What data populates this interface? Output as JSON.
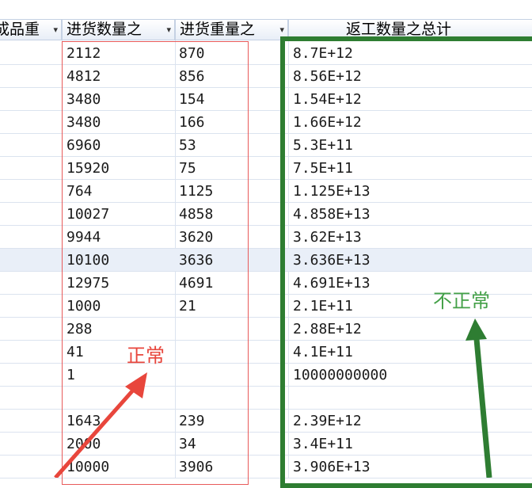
{
  "headers": {
    "col0": "成品重",
    "col1": "进货数量之",
    "col2": "进货重量之",
    "col3": "返工数量之总计",
    "dropdown_glyph": "▾"
  },
  "rows": [
    {
      "c1": "2112",
      "c2": "870",
      "c3": "8.7E+12"
    },
    {
      "c1": "4812",
      "c2": "856",
      "c3": "8.56E+12"
    },
    {
      "c1": "3480",
      "c2": "154",
      "c3": "1.54E+12"
    },
    {
      "c1": "3480",
      "c2": "166",
      "c3": "1.66E+12"
    },
    {
      "c1": "6960",
      "c2": "53",
      "c3": "5.3E+11"
    },
    {
      "c1": "15920",
      "c2": "75",
      "c3": "7.5E+11"
    },
    {
      "c1": "764",
      "c2": "1125",
      "c3": "1.125E+13"
    },
    {
      "c1": "10027",
      "c2": "4858",
      "c3": "4.858E+13"
    },
    {
      "c1": "9944",
      "c2": "3620",
      "c3": "3.62E+13"
    },
    {
      "c1": "10100",
      "c2": "3636",
      "c3": "3.636E+13"
    },
    {
      "c1": "12975",
      "c2": "4691",
      "c3": "4.691E+13"
    },
    {
      "c1": "1000",
      "c2": "21",
      "c3": "2.1E+11"
    },
    {
      "c1": "288",
      "c2": "",
      "c3": "2.88E+12"
    },
    {
      "c1": "41",
      "c2": "",
      "c3": "4.1E+11"
    },
    {
      "c1": "1",
      "c2": "",
      "c3": "10000000000"
    },
    {
      "c1": "",
      "c2": "",
      "c3": ""
    },
    {
      "c1": "1643",
      "c2": "239",
      "c3": "2.39E+12"
    },
    {
      "c1": "2000",
      "c2": "34",
      "c3": "3.4E+11"
    },
    {
      "c1": "10000",
      "c2": "3906",
      "c3": "3.906E+13"
    }
  ],
  "annotations": {
    "normal_label": "正常",
    "abnormal_label": "不正常"
  },
  "colors": {
    "red_annotation": "#e8463c",
    "green_annotation": "#2e7d32",
    "header_bg": "#e8eef7",
    "selected_row_bg": "#e9eff8"
  }
}
